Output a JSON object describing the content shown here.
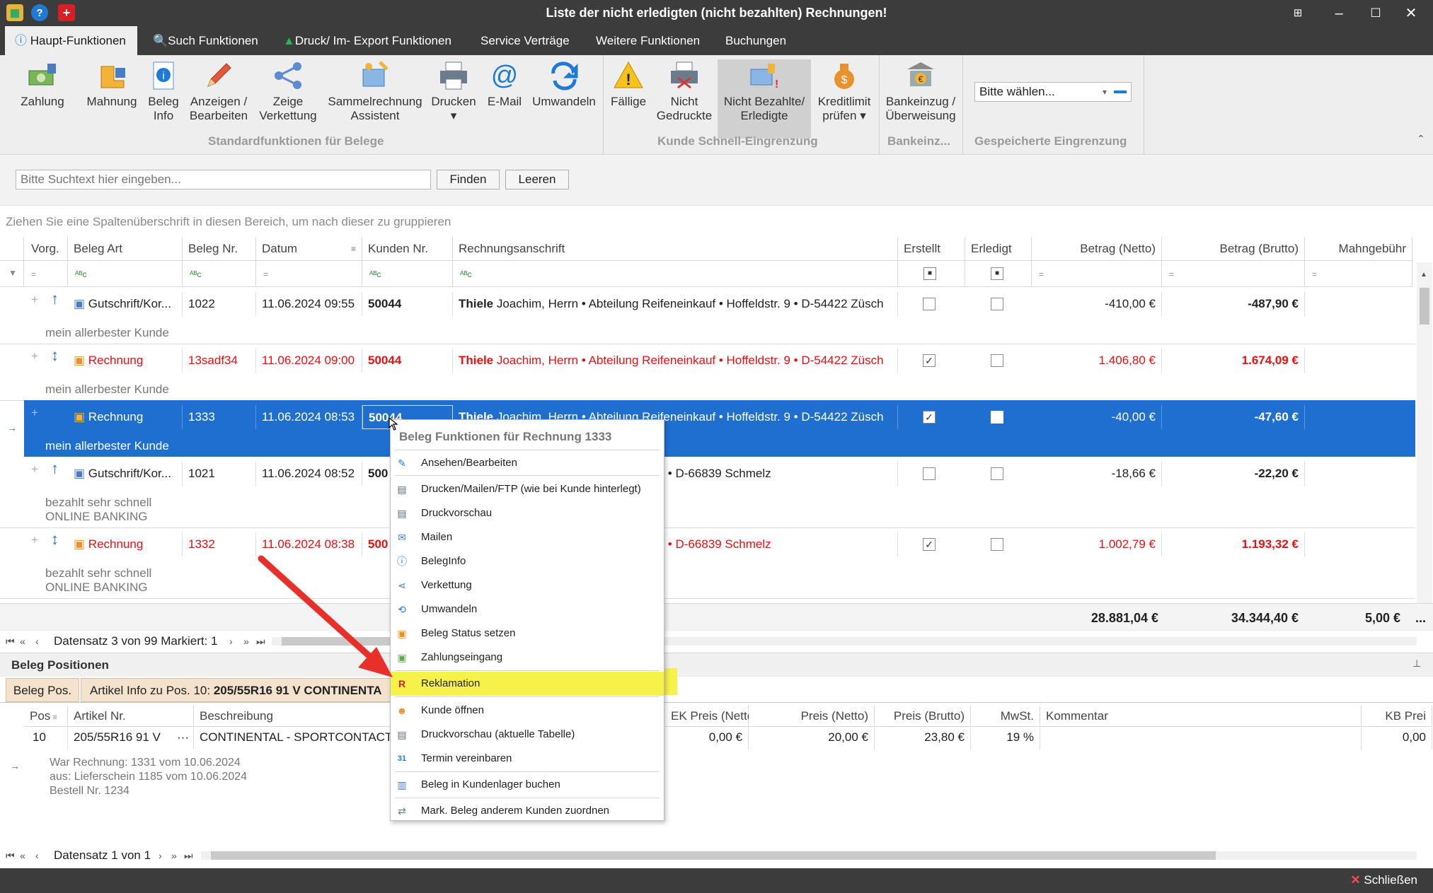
{
  "window": {
    "title": "Liste der nicht erledigten (nicht bezahlten) Rechnungen!",
    "help_icon": "?",
    "close_label": "✕"
  },
  "menu": [
    "Haupt-Funktionen",
    "Such Funktionen",
    "Druck/ Im- Export Funktionen",
    "Service Verträge",
    "Weitere Funktionen",
    "Buchungen"
  ],
  "ribbon": {
    "buttons": [
      {
        "l1": "Zahlung",
        "l2": ""
      },
      {
        "l1": "Mahnung",
        "l2": ""
      },
      {
        "l1": "Beleg",
        "l2": "Info"
      },
      {
        "l1": "Anzeigen /",
        "l2": "Bearbeiten"
      },
      {
        "l1": "Zeige",
        "l2": "Verkettung"
      },
      {
        "l1": "Sammelrechnung",
        "l2": "Assistent"
      },
      {
        "l1": "Drucken",
        "l2": "▾"
      },
      {
        "l1": "E-Mail",
        "l2": ""
      },
      {
        "l1": "Umwandeln",
        "l2": ""
      },
      {
        "l1": "Fällige",
        "l2": ""
      },
      {
        "l1": "Nicht",
        "l2": "Gedruckte"
      },
      {
        "l1": "Nicht Bezahlte/",
        "l2": "Erledigte"
      },
      {
        "l1": "Kreditlimit",
        "l2": "prüfen ▾"
      },
      {
        "l1": "Bankeinzug /",
        "l2": "Überweisung"
      }
    ],
    "groups": [
      "Standardfunktionen für Belege",
      "Kunde Schnell-Eingrenzung",
      "Bankeinz...",
      "Gespeicherte Eingrenzung"
    ],
    "select_value": "Bitte wählen..."
  },
  "search": {
    "placeholder": "Bitte Suchtext hier eingeben...",
    "find": "Finden",
    "clear": "Leeren"
  },
  "group_hint": "Ziehen Sie eine Spaltenüberschrift in diesen Bereich, um nach dieser zu gruppieren",
  "columns": [
    "Vorg.",
    "Beleg Art",
    "Beleg Nr.",
    "Datum",
    "Kunden Nr.",
    "Rechnungsanschrift",
    "Erstellt",
    "Erledigt",
    "Betrag (Netto)",
    "Betrag (Brutto)",
    "Mahngebühr"
  ],
  "rows": [
    {
      "art": "Gutschrift/Kor...",
      "nr": "1022",
      "datum": "11.06.2024 09:55",
      "kunde": "50044",
      "name": "Thiele",
      "addr": " Joachim, Herrn • Abteilung Reifeneinkauf • Hoffeldstr. 9 • D-54422 Züsch",
      "erstellt": "",
      "erledigt": "",
      "netto": "-410,00 €",
      "brutto": "-487,90 €",
      "note1": "mein allerbester Kunde",
      "note2": ""
    },
    {
      "art": "Rechnung",
      "nr": "13sadf34",
      "datum": "11.06.2024 09:00",
      "kunde": "50044",
      "name": "Thiele",
      "addr": " Joachim, Herrn • Abteilung Reifeneinkauf • Hoffeldstr. 9 • D-54422 Züsch",
      "erstellt": "✓",
      "erledigt": "",
      "netto": "1.406,80 €",
      "brutto": "1.674,09 €",
      "note1": "mein allerbester Kunde",
      "note2": ""
    },
    {
      "art": "Rechnung",
      "nr": "1333",
      "datum": "11.06.2024 08:53",
      "kunde": "50044",
      "name": "Thiele",
      "addr": " Joachim, Herrn • Abteilung Reifeneinkauf • Hoffeldstr. 9 • D-54422 Züsch",
      "erstellt": "✓",
      "erledigt": "",
      "netto": "-40,00 €",
      "brutto": "-47,60 €",
      "note1": "mein allerbester Kunde",
      "note2": ""
    },
    {
      "art": "Gutschrift/Kor...",
      "nr": "1021",
      "datum": "11.06.2024 08:52",
      "kunde": "500",
      "name": "",
      "addr": "r. 40 • D-66839 Schmelz",
      "erstellt": "",
      "erledigt": "",
      "netto": "-18,66 €",
      "brutto": "-22,20 €",
      "note1": "bezahlt sehr schnell",
      "note2": "ONLINE BANKING"
    },
    {
      "art": "Rechnung",
      "nr": "1332",
      "datum": "11.06.2024 08:38",
      "kunde": "500",
      "name": "",
      "addr": "r. 40 • D-66839 Schmelz",
      "erstellt": "✓",
      "erledigt": "",
      "netto": "1.002,79 €",
      "brutto": "1.193,32 €",
      "note1": "bezahlt sehr schnell",
      "note2": "ONLINE BANKING"
    }
  ],
  "totals": {
    "netto": "28.881,04 €",
    "brutto": "34.344,40 €",
    "mahn": "5,00 €",
    "more": "..."
  },
  "nav": {
    "text": "Datensatz 3 von 99 Markiert: 1"
  },
  "context_menu": {
    "title": "Beleg Funktionen für Rechnung 1333",
    "items": [
      "Ansehen/Bearbeiten",
      "Drucken/Mailen/FTP (wie bei Kunde hinterlegt)",
      "Druckvorschau",
      "Mailen",
      "BelegInfo",
      "Verkettung",
      "Umwandeln",
      "Beleg Status setzen",
      "Zahlungseingang",
      "Reklamation",
      "Kunde öffnen",
      "Druckvorschau (aktuelle Tabelle)",
      "Termin vereinbaren",
      "Beleg in Kundenlager buchen",
      "Mark. Beleg  anderem Kunden zuordnen"
    ]
  },
  "positions": {
    "panel_title": "Beleg Positionen",
    "tab1": "Beleg Pos.",
    "tab2_prefix": "Artikel Info zu Pos. 10: ",
    "tab2_bold": "205/55R16 91 V CONTINENTA",
    "columns": [
      "Pos",
      "Artikel Nr.",
      "Beschreibung",
      "EK Preis (Netto)",
      "Preis (Netto)",
      "Preis (Brutto)",
      "MwSt.",
      "Kommentar",
      "KB Prei"
    ],
    "row": {
      "pos": "10",
      "artikel": "205/55R16 91 V",
      "beschr": "CONTINENTAL - SPORTCONTACT FR",
      "ek": "0,00 €",
      "netto": "20,00 €",
      "brutto": "23,80 €",
      "mwst": "19 %",
      "kb": "0,00"
    },
    "notes": [
      "War Rechnung: 1331 vom 10.06.2024",
      "aus: Lieferschein 1185 vom 10.06.2024",
      "Bestell Nr. 1234"
    ],
    "nav": "Datensatz 1 von 1"
  },
  "status": {
    "close": "Schließen"
  },
  "colors": {
    "titlebar": "#3c3c3c",
    "selection": "#1f6fd1",
    "highlight": "#f7f24a",
    "arrow": "#e8302a",
    "red_text": "#e81010"
  }
}
